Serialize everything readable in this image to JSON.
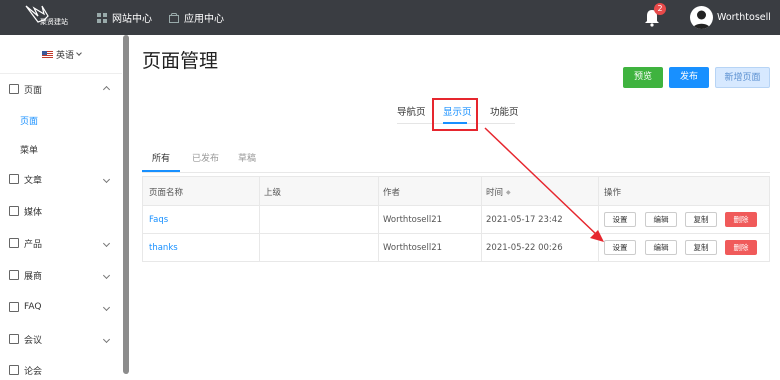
{
  "header": {
    "logo_text": "聚贤建站",
    "nav": [
      {
        "label": "网站中心",
        "icon": "grid-icon"
      },
      {
        "label": "应用中心",
        "icon": "box-icon"
      }
    ],
    "notification_count": "2",
    "username": "Worthtosell"
  },
  "sidebar": {
    "language": "英语",
    "items": [
      {
        "label": "页面",
        "icon": "page-icon",
        "expanded": true,
        "children": [
          {
            "label": "页面",
            "active": true
          },
          {
            "label": "菜单",
            "active": false
          }
        ]
      },
      {
        "label": "文章",
        "icon": "article-icon"
      },
      {
        "label": "媒体",
        "icon": "media-icon"
      },
      {
        "label": "产品",
        "icon": "product-icon"
      },
      {
        "label": "展商",
        "icon": "exhibitor-icon"
      },
      {
        "label": "FAQ",
        "icon": "faq-icon"
      },
      {
        "label": "会议",
        "icon": "meeting-icon"
      },
      {
        "label": "论会",
        "icon": "forum-icon"
      }
    ]
  },
  "main": {
    "title": "页面管理",
    "buttons": {
      "preview": "预览",
      "publish": "发布",
      "new_page": "新增页面"
    },
    "page_tabs": [
      {
        "label": "导航页",
        "active": false
      },
      {
        "label": "显示页",
        "active": true
      },
      {
        "label": "功能页",
        "active": false
      }
    ],
    "status_tabs": [
      {
        "label": "所有",
        "active": true
      },
      {
        "label": "已发布",
        "active": false
      },
      {
        "label": "草稿",
        "active": false
      }
    ],
    "table": {
      "headers": [
        "页面名称",
        "上级",
        "作者",
        "时间",
        "操作"
      ],
      "rows": [
        {
          "name": "Faqs",
          "parent": "",
          "author": "Worthtosell21",
          "time": "2021-05-17 23:42"
        },
        {
          "name": "thanks",
          "parent": "",
          "author": "Worthtosell21",
          "time": "2021-05-22 00:26"
        }
      ],
      "actions": {
        "settings": "设置",
        "edit": "编辑",
        "copy": "复制",
        "delete": "删除"
      }
    }
  },
  "colors": {
    "topbar": "#3a3d42",
    "primary": "#1890ff",
    "success": "#3fb33f",
    "danger": "#f05a5a",
    "highlight": "#e6262e"
  }
}
